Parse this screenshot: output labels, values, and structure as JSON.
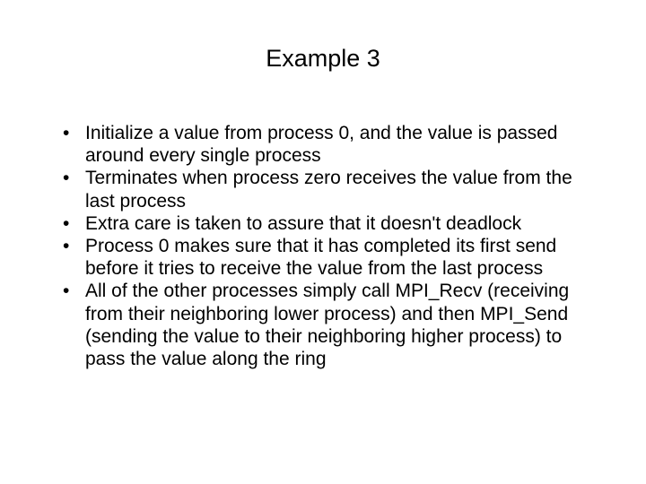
{
  "slide": {
    "title": "Example 3",
    "bullets": [
      "Initialize a value from process 0, and the value is passed around every single process",
      "Terminates when process zero receives the value from the last process",
      "Extra care is taken to assure that it doesn't deadlock",
      "Process 0 makes sure that it has completed its first send before it tries to receive the value from the last process",
      "All of the other processes simply call MPI_Recv (receiving from their neighboring lower process) and then MPI_Send (sending the value to their neighboring higher process) to pass the value along the ring"
    ]
  }
}
